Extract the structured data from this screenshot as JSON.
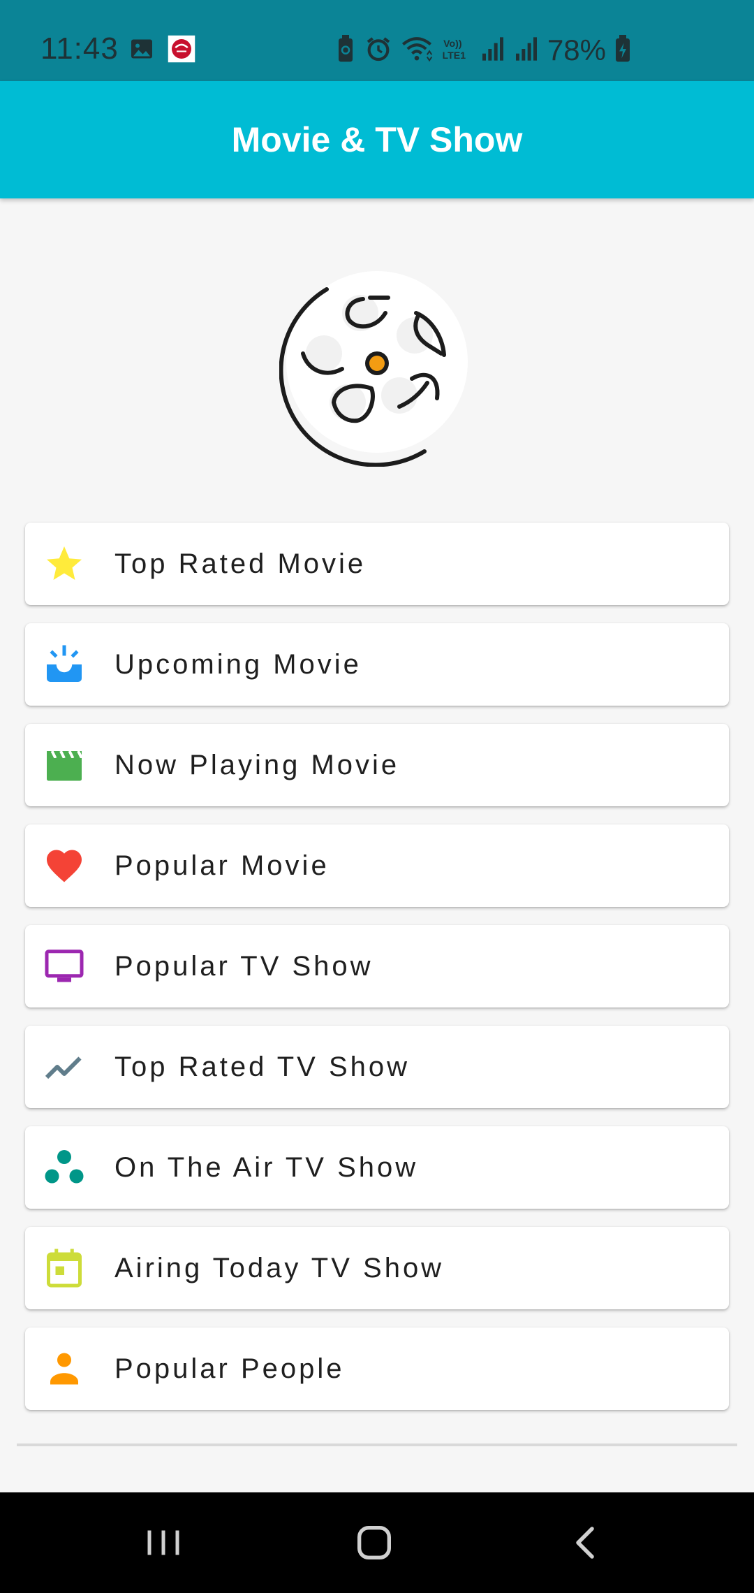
{
  "status_bar": {
    "time": "11:43",
    "battery_percent": "78%",
    "icons": [
      "gallery-icon",
      "pizza-app-icon",
      "battery-saver-icon",
      "alarm-icon",
      "wifi-icon",
      "volte-icon",
      "signal-icon",
      "signal-icon",
      "battery-charging-icon"
    ],
    "network_label": "Vo)) LTE1"
  },
  "app_bar": {
    "title": "Movie & TV Show",
    "color": "#00bcd4"
  },
  "hero": {
    "icon": "film-reel-icon",
    "accent": "#f39c12"
  },
  "menu": [
    {
      "label": "Top Rated Movie",
      "icon": "star-icon",
      "color": "#ffeb3b"
    },
    {
      "label": "Upcoming Movie",
      "icon": "upcoming-icon",
      "color": "#2196f3"
    },
    {
      "label": "Now Playing Movie",
      "icon": "clapperboard-icon",
      "color": "#4caf50"
    },
    {
      "label": "Popular Movie",
      "icon": "heart-icon",
      "color": "#f44336"
    },
    {
      "label": "Popular TV Show",
      "icon": "tv-icon",
      "color": "#9c27b0"
    },
    {
      "label": "Top Rated TV Show",
      "icon": "trending-icon",
      "color": "#607d8b"
    },
    {
      "label": "On The Air TV Show",
      "icon": "bubbles-icon",
      "color": "#009688"
    },
    {
      "label": "Airing Today TV Show",
      "icon": "calendar-today-icon",
      "color": "#cddc39"
    },
    {
      "label": "Popular People",
      "icon": "person-icon",
      "color": "#ff9800"
    }
  ],
  "nav_bar": {
    "buttons": [
      "recents-icon",
      "home-icon",
      "back-icon"
    ]
  }
}
